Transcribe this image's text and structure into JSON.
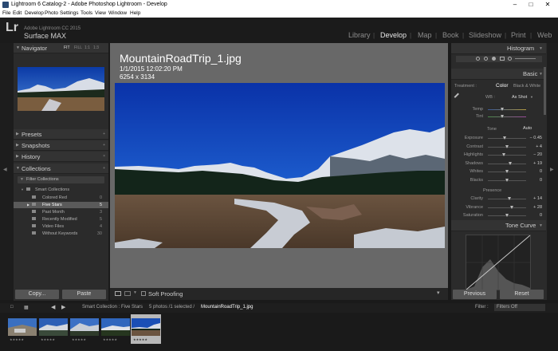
{
  "window": {
    "title": "Lightroom 6 Catalog-2 - Adobe Photoshop Lightroom - Develop"
  },
  "menu": [
    "File",
    "Edit",
    "Develop",
    "Photo",
    "Settings",
    "Tools",
    "View",
    "Window",
    "Help"
  ],
  "identity": {
    "logo": "Lr",
    "line1": "Adobe Lightroom CC 2015",
    "line2": "Surface MAX"
  },
  "modules": [
    "Library",
    "Develop",
    "Map",
    "Book",
    "Slideshow",
    "Print",
    "Web"
  ],
  "active_module": "Develop",
  "left": {
    "navigator": {
      "title": "Navigator",
      "zoom": [
        "FIT",
        "FILL",
        "1:1",
        "1:3"
      ]
    },
    "panels": [
      "Presets",
      "Snapshots",
      "History",
      "Collections"
    ],
    "filter": "Filter Collections",
    "smart_collections": "Smart Collections",
    "collections": [
      {
        "name": "Colored Red",
        "count": "0"
      },
      {
        "name": "Five Stars",
        "count": "5"
      },
      {
        "name": "Past Month",
        "count": "3"
      },
      {
        "name": "Recently Modified",
        "count": "5"
      },
      {
        "name": "Video Files",
        "count": "4"
      },
      {
        "name": "Without Keywords",
        "count": "30"
      }
    ],
    "copy": "Copy...",
    "paste": "Paste"
  },
  "photo_info": {
    "filename": "MountainRoadTrip_1.jpg",
    "datetime": "1/1/2015 12:02:20 PM",
    "dimensions": "6254 x 3134"
  },
  "toolbar": {
    "soft_proofing": "Soft Proofing"
  },
  "right": {
    "histogram": "Histogram",
    "basic": "Basic",
    "treatment_label": "Treatment :",
    "treatment_color": "Color",
    "treatment_bw": "Black & White",
    "wb_label": "WB :",
    "wb_value": "As Shot",
    "temp": "Temp",
    "tint": "Tint",
    "tone": "Tone",
    "auto": "Auto",
    "sliders": [
      {
        "label": "Exposure",
        "value": "− 0.45",
        "level": 0.45
      },
      {
        "label": "Contrast",
        "value": "+ 4",
        "level": 0.52
      },
      {
        "label": "Highlights",
        "value": "− 20",
        "level": 0.42
      },
      {
        "label": "Shadows",
        "value": "+ 19",
        "level": 0.6
      },
      {
        "label": "Whites",
        "value": "0",
        "level": 0.5
      },
      {
        "label": "Blacks",
        "value": "0",
        "level": 0.5
      }
    ],
    "presence": "Presence",
    "presence_sliders": [
      {
        "label": "Clarity",
        "value": "+ 14",
        "level": 0.57
      },
      {
        "label": "Vibrance",
        "value": "+ 28",
        "level": 0.64
      },
      {
        "label": "Saturation",
        "value": "0",
        "level": 0.5
      }
    ],
    "tone_curve": "Tone Curve",
    "previous": "Previous",
    "reset": "Reset"
  },
  "filmbar": {
    "source": "Smart Collection : Five Stars",
    "count": "5 photos /1 selected /",
    "selected": "MountainRoadTrip_1.jpg",
    "filter_label": "Filter :",
    "filter_value": "Filters Off"
  },
  "filmstrip": {
    "stars": "★★★★★"
  }
}
